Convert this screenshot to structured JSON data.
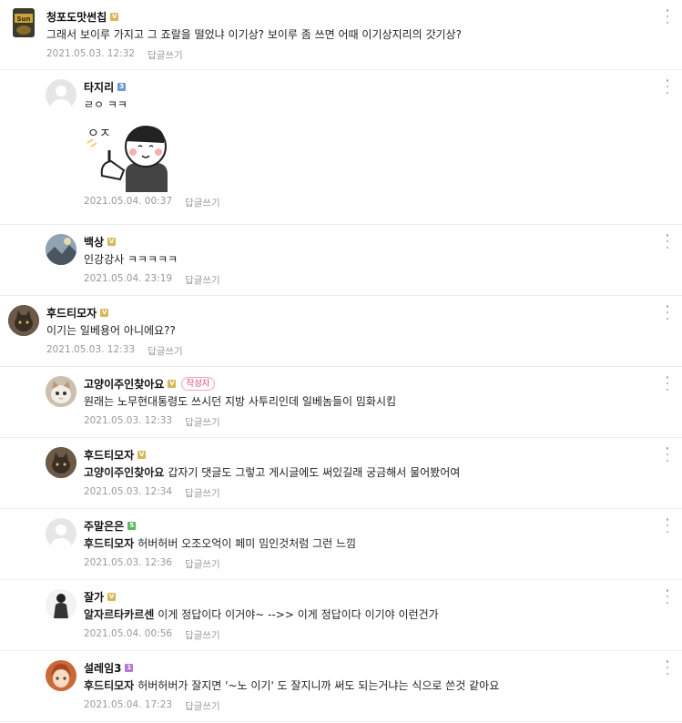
{
  "comments": [
    {
      "nick": "청포도맛썬칩",
      "level": "gold",
      "level_char": "V",
      "text": "그래서 보이루 가지고 그 죠랄을 떨었냐 이기상? 보이루 좀 쓰면 어때 이기상지리의 갓기상?",
      "date": "2021.05.03. 12:32",
      "reply": "답글쓰기",
      "avatar_icon": "snack-bag-avatar-icon"
    },
    {
      "nick": "타지리",
      "level": "blue",
      "level_char": "3",
      "text": "ㄹㅇ ㅋㅋ",
      "sticker_text": "ㅇㅈ",
      "date": "2021.05.04. 00:37",
      "reply": "답글쓰기",
      "avatar_icon": "default-profile-icon"
    },
    {
      "nick": "백상",
      "level": "gold",
      "level_char": "V",
      "text": "인강강사 ㅋㅋㅋㅋㅋ",
      "date": "2021.05.04. 23:19",
      "reply": "답글쓰기",
      "avatar_icon": "landscape-avatar-icon"
    },
    {
      "nick": "후드티모자",
      "level": "gold",
      "level_char": "V",
      "text": "이기는 일베용어 아니에요??",
      "date": "2021.05.03. 12:33",
      "reply": "답글쓰기",
      "avatar_icon": "cat-avatar-icon"
    },
    {
      "nick": "고양이주인찾아요",
      "level": "gold",
      "level_char": "V",
      "badge": "작성자",
      "text": "원래는 노무현대통령도 쓰시던 지방 사투리인데 일베놈들이 밈화시킴",
      "date": "2021.05.03. 12:33",
      "reply": "답글쓰기",
      "avatar_icon": "kitten-avatar-icon"
    },
    {
      "nick": "후드티모자",
      "level": "gold",
      "level_char": "V",
      "mention": "고양이주인찾아요",
      "text": "갑자기 댓글도 그렇고 게시글에도 써있길래 궁금해서 물어봤어여",
      "date": "2021.05.03. 12:34",
      "reply": "답글쓰기",
      "avatar_icon": "cat-avatar-icon"
    },
    {
      "nick": "주말은은",
      "level": "green",
      "level_char": "5",
      "mention": "후드티모자",
      "text": "허버허버 오조오억이 페미 밈인것처럼 그런 느낌",
      "date": "2021.05.03. 12:36",
      "reply": "답글쓰기",
      "avatar_icon": "default-profile-icon"
    },
    {
      "nick": "잘가",
      "level": "gold",
      "level_char": "V",
      "mention": "알자르타카르센",
      "text": "이게 정답이다 이거야~ -->> 이게 정답이다 이기야 이런건가",
      "date": "2021.05.04. 00:56",
      "reply": "답글쓰기",
      "avatar_icon": "figure-avatar-icon"
    },
    {
      "nick": "설레임3",
      "level": "purple",
      "level_char": "1",
      "mention": "후드티모자",
      "text": "허버허버가 잘지면 '~노 이기' 도 잘지니까 써도 되는거냐는 식으로 쓴것 같아요",
      "date": "2021.05.04. 17:23",
      "reply": "답글쓰기",
      "avatar_icon": "anime-girl-avatar-icon"
    }
  ]
}
